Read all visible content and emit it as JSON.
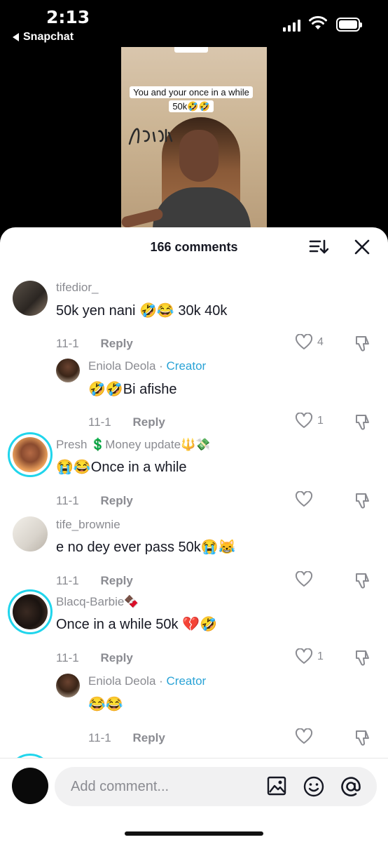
{
  "status_bar": {
    "time": "2:13",
    "back_app": "Snapchat"
  },
  "video": {
    "caption_line1": "You and your once in a while",
    "caption_line2": "50k🤣🤣"
  },
  "sheet": {
    "comment_count": "166 comments"
  },
  "comments": [
    {
      "username": "tifedior_",
      "text": "50k yen nani 🤣😂 30k 40k",
      "date": "11-1",
      "reply_label": "Reply",
      "likes": "4"
    },
    {
      "username": "Eniola Deola",
      "badge": "Creator",
      "text": "🤣🤣Bi afishe",
      "date": "11-1",
      "reply_label": "Reply",
      "likes": "1"
    },
    {
      "username": "Presh 💲Money update🔱💸",
      "text": "😭😂Once in a while",
      "date": "11-1",
      "reply_label": "Reply",
      "likes": ""
    },
    {
      "username": "tife_brownie",
      "text": "e no dey ever pass 50k😭😹",
      "date": "11-1",
      "reply_label": "Reply",
      "likes": ""
    },
    {
      "username": "Blacq-Barbie🍫",
      "text": "Once in a while 50k 💔🤣",
      "date": "11-1",
      "reply_label": "Reply",
      "likes": "1"
    },
    {
      "username": "Eniola Deola",
      "badge": "Creator",
      "text": "😂😂",
      "date": "11-1",
      "reply_label": "Reply",
      "likes": ""
    }
  ],
  "composer": {
    "placeholder": "Add comment..."
  },
  "colors": {
    "accent_ring": "#20d5ec",
    "creator_badge": "#2aa3d6",
    "secondary_text": "#8a8b91"
  }
}
